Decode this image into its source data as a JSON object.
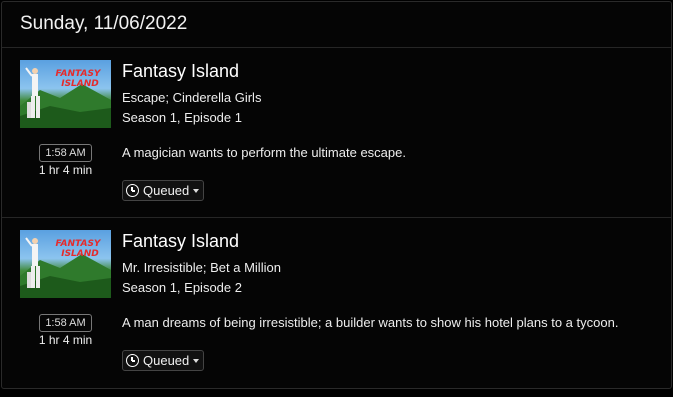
{
  "header": {
    "date": "Sunday, 11/06/2022"
  },
  "episodes": [
    {
      "show_title": "Fantasy Island",
      "episode_title": "Escape; Cinderella Girls",
      "season_episode": "Season 1, Episode 1",
      "time": "1:58 AM",
      "duration": "1 hr 4 min",
      "description": "A magician wants to perform the ultimate escape.",
      "status": "Queued",
      "thumbnail_text": "FANTASY ISLAND"
    },
    {
      "show_title": "Fantasy Island",
      "episode_title": "Mr. Irresistible; Bet a Million",
      "season_episode": "Season 1, Episode 2",
      "time": "1:58 AM",
      "duration": "1 hr 4 min",
      "description": "A man dreams of being irresistible; a builder wants to show his hotel plans to a tycoon.",
      "status": "Queued",
      "thumbnail_text": "FANTASY ISLAND"
    }
  ],
  "colors": {
    "background": "#000000",
    "border": "#262626",
    "text": "#ffffff"
  }
}
